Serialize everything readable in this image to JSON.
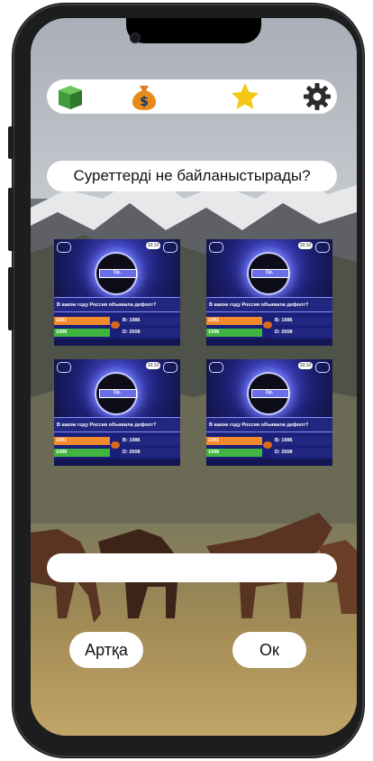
{
  "topbar": {
    "icons": [
      "layers-icon",
      "money-bag-icon",
      "star-icon",
      "gear-icon"
    ],
    "colors": {
      "layers": "#3f9a3a",
      "money": "#e8891c",
      "star": "#f5c815",
      "gear": "#2b2b2b"
    }
  },
  "question": "Суреттерді не байланыстырады?",
  "thumbs": [
    {
      "center": "Ор.",
      "timer": "10:10",
      "q": "В каком году Россия объявила дефолт?",
      "a1": "1991",
      "a2": "1998",
      "b1": "1986",
      "b2": "2008",
      "bk1": "В:",
      "bk2": "D:"
    },
    {
      "center": "Ор.",
      "timer": "10:10",
      "q": "В каком году Россия объявила дефолт?",
      "a1": "1991",
      "a2": "1998",
      "b1": "1986",
      "b2": "2008",
      "bk1": "В:",
      "bk2": "D:"
    },
    {
      "center": "Ор.",
      "timer": "10:10",
      "q": "В каком году Россия объявила дефолт?",
      "a1": "1991",
      "a2": "1998",
      "b1": "1986",
      "b2": "2008",
      "bk1": "В:",
      "bk2": "D:"
    },
    {
      "center": "Ор.",
      "timer": "10:10",
      "q": "В каком году Россия объявила дефолт?",
      "a1": "1991",
      "a2": "1998",
      "b1": "1986",
      "b2": "2008",
      "bk1": "В:",
      "bk2": "D:"
    }
  ],
  "answer_value": "",
  "buttons": {
    "back": "Артқа",
    "ok": "Ок"
  }
}
